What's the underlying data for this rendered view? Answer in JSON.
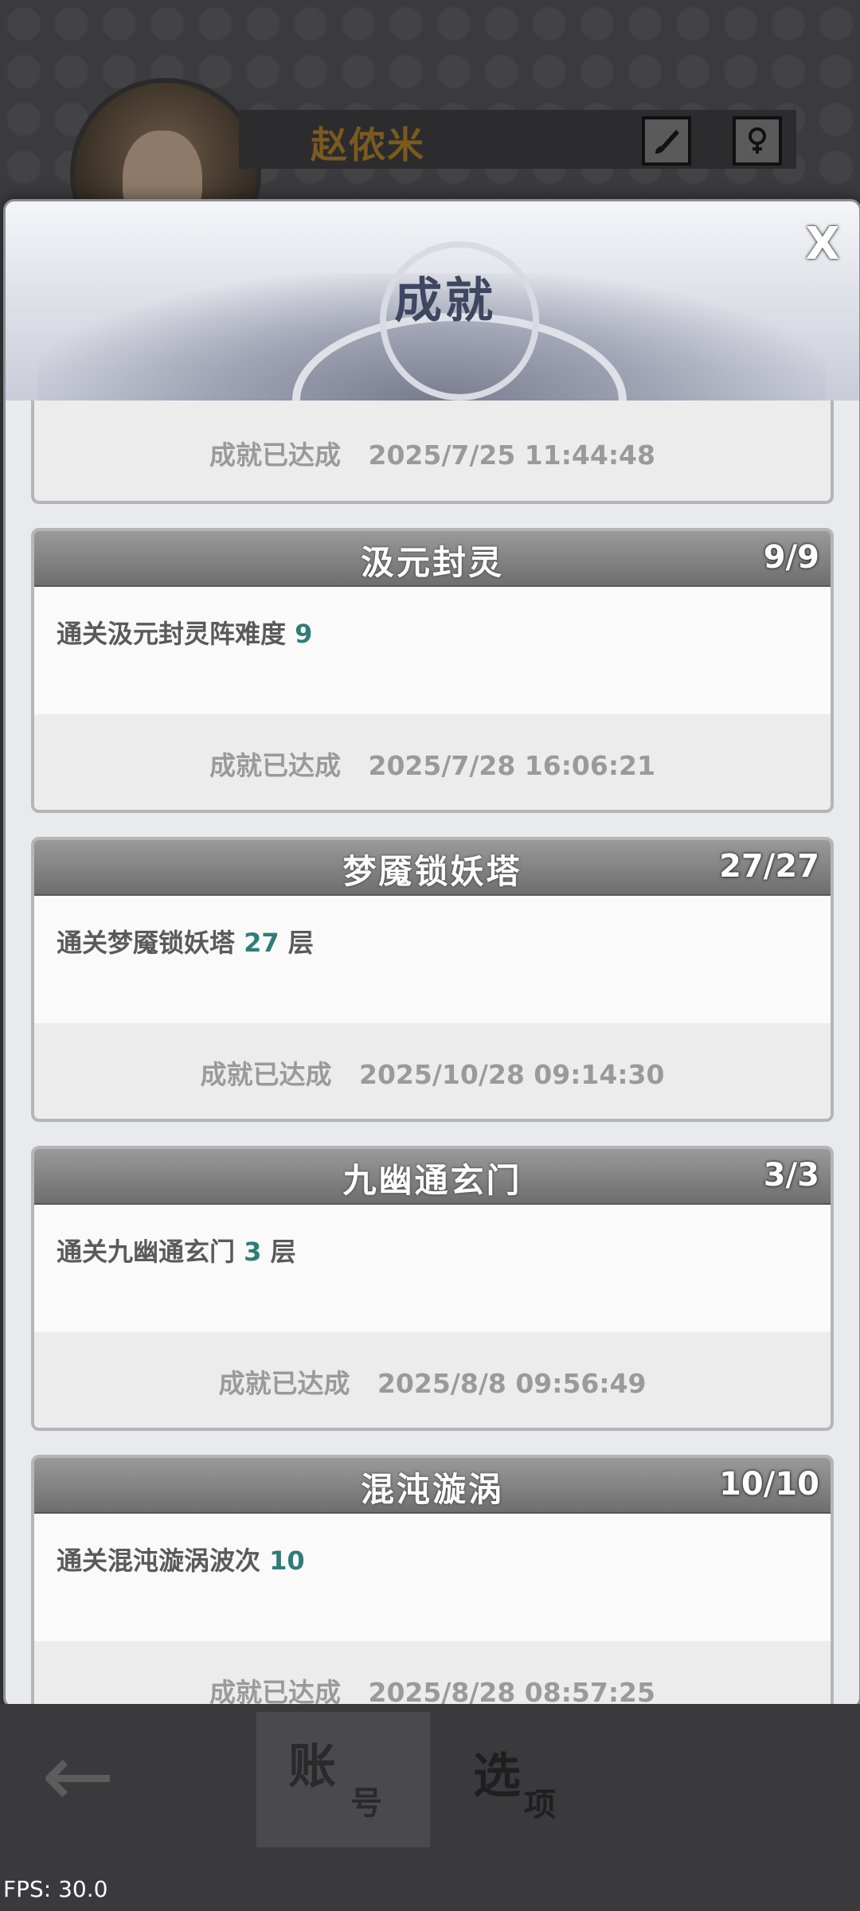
{
  "profile": {
    "name": "赵侬米"
  },
  "modal": {
    "title": "成就",
    "close_label": "X",
    "top_partial": {
      "status": "成就已达成   2025/7/25 11:44:48"
    },
    "cards": [
      {
        "title": "汲元封灵",
        "count": "9/9",
        "desc_text": "通关汲元封灵阵难度 ",
        "desc_num": "9",
        "desc_suffix": "",
        "status": "成就已达成   2025/7/28 16:06:21"
      },
      {
        "title": "梦魇锁妖塔",
        "count": "27/27",
        "desc_text": "通关梦魇锁妖塔 ",
        "desc_num": "27",
        "desc_suffix": " 层",
        "status": "成就已达成   2025/10/28 09:14:30"
      },
      {
        "title": "九幽通玄门",
        "count": "3/3",
        "desc_text": "通关九幽通玄门 ",
        "desc_num": "3",
        "desc_suffix": " 层",
        "status": "成就已达成   2025/8/8 09:56:49"
      },
      {
        "title": "混沌漩涡",
        "count": "10/10",
        "desc_text": "通关混沌漩涡波次 ",
        "desc_num": "10",
        "desc_suffix": "",
        "status": "成就已达成   2025/8/28 08:57:25"
      }
    ]
  },
  "nav": {
    "back_icon": "←",
    "tab_account_main": "账",
    "tab_account_sub": "号",
    "tab_options_main": "选",
    "tab_options_sub": "项"
  },
  "fps": "FPS: 30.0"
}
